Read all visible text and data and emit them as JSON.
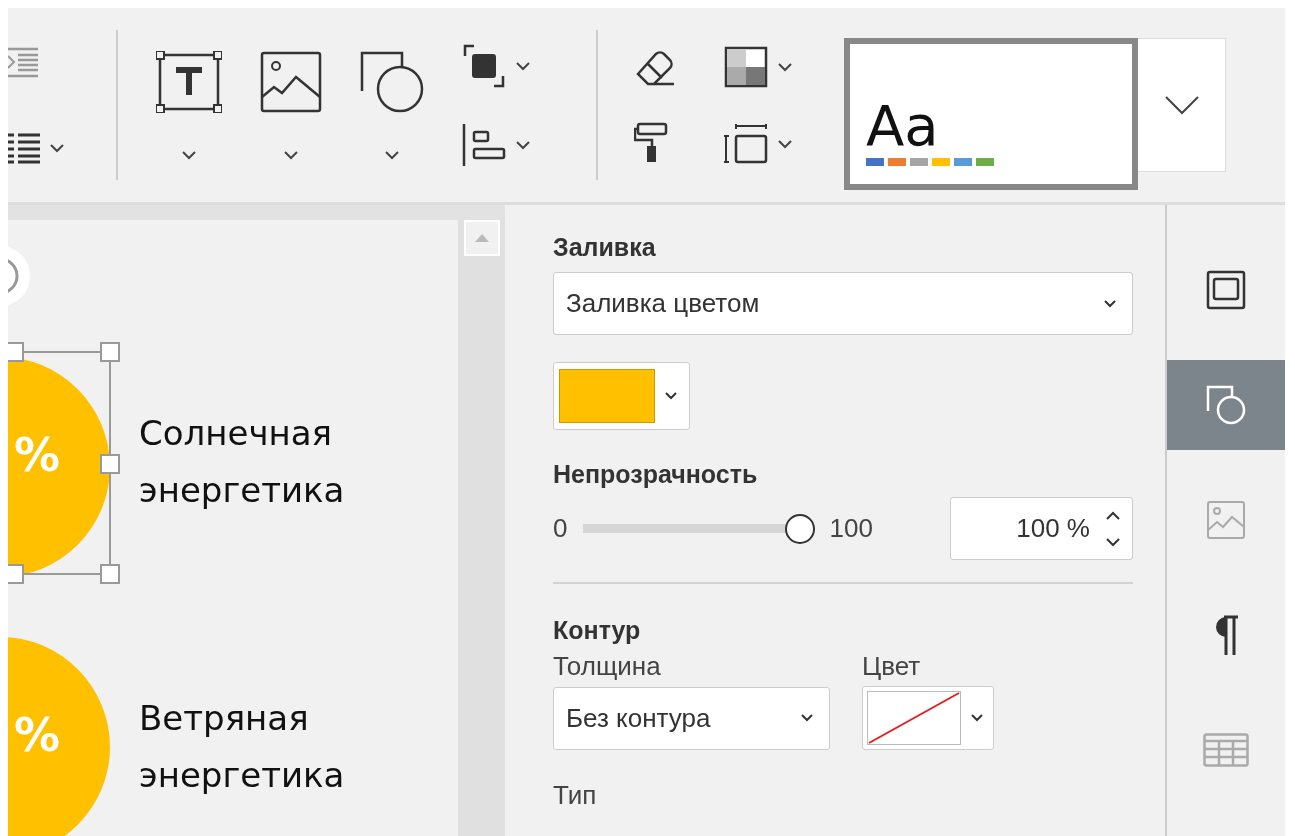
{
  "toolbar": {
    "theme_preview": {
      "label": "Aa",
      "colors": [
        {
          "color": "#4472c4"
        },
        {
          "color": "#ed7d31"
        },
        {
          "color": "#a5a5a5"
        },
        {
          "color": "#ffc000"
        },
        {
          "color": "#5b9bd5"
        },
        {
          "color": "#70ad47"
        }
      ]
    }
  },
  "slide": {
    "items": [
      {
        "value": "%",
        "label": "Солнечная энергетика",
        "selected": true
      },
      {
        "value": "%",
        "label": "Ветряная энергетика",
        "selected": false
      }
    ]
  },
  "settings": {
    "fill": {
      "title": "Заливка",
      "type": "Заливка цветом",
      "color": "#ffc000"
    },
    "opacity": {
      "title": "Непрозрачность",
      "min": "0",
      "max": "100",
      "level": 1,
      "value": "100 %"
    },
    "outline": {
      "title": "Контур",
      "thickness_label": "Толщина",
      "thickness": "Без контура",
      "color_label": "Цвет",
      "no_color": true,
      "type_label": "Тип"
    }
  },
  "right_tabs": [
    {
      "kind": "slide",
      "selected": false,
      "disabled": false
    },
    {
      "kind": "shape",
      "selected": true,
      "disabled": false
    },
    {
      "kind": "image",
      "selected": false,
      "disabled": true
    },
    {
      "kind": "paragraph",
      "selected": false,
      "disabled": false
    },
    {
      "kind": "table",
      "selected": false,
      "disabled": true
    }
  ]
}
